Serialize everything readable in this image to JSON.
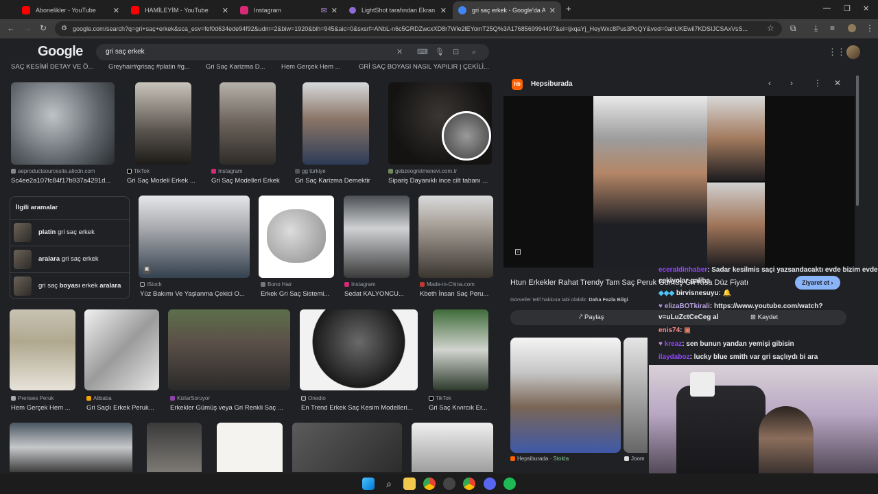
{
  "browser": {
    "tabs": [
      {
        "title": "Abonelikler - YouTube",
        "color": "#ff0000"
      },
      {
        "title": "HAMİLEYİM - YouTube",
        "color": "#ff0000"
      },
      {
        "title": "Instagram",
        "color": "#d62976"
      },
      {
        "title": "LightShot tarafından Ekran Gör...",
        "color": "#8e6bd6"
      },
      {
        "title": "gri saç erkek - Google'da Ara",
        "color": "#4285f4"
      }
    ],
    "url": "google.com/search?q=gri+saç+erkek&sca_esv=fef0d634ede94f92&udm=2&biw=1920&bih=945&aic=0&sxsrf=ANbL-n6c5GRDZwcxXD8r7Wle2lEYomT25Q%3A1768569994497&ei=ijxqaYj_HeyWxc8Pus3PoQY&ved=0ahUKEwil7KDSIJCSAxVsS..."
  },
  "google": {
    "logo": "Google",
    "query": "gri saç erkek",
    "chips": [
      "SAÇ KESİMİ DETAY VE Ö...",
      "Greyhair#grisaç #platin #g...",
      "Gri Saç Karizma D...",
      "Hem Gerçek Hem ...",
      "GRİ SAÇ BOYASI NASIL YAPILIR | ÇEKİLİ..."
    ]
  },
  "results": {
    "row1": [
      {
        "source": "aeproductsourcesite.alicdn.com",
        "caption": "Sc4ee2a107fc84f17b937a4291d..."
      },
      {
        "source": "TikTok",
        "caption": "Gri Saç Modeli Erkek ..."
      },
      {
        "source": "Instagram",
        "caption": "Gri Saç Modelleri Erkek"
      },
      {
        "source": "gg türkiye",
        "caption": "Gri Saç Karizma Demektir"
      },
      {
        "source": "gebzeogretmenevi.com.tr",
        "caption": "Sipariş Dayanıklı ince cilt tabanı ..."
      }
    ],
    "row2": [
      {
        "source": "iStock",
        "caption": "Yüz Bakımı Ve Yaşlanma Çekici O..."
      },
      {
        "source": "Bono Hair",
        "caption": "Erkek Gri Saç Sistemi..."
      },
      {
        "source": "Instagram",
        "caption": "Sedat KALYONCU..."
      },
      {
        "source": "Made-in-China.com",
        "caption": "Kbeth İnsan Saç Peru..."
      }
    ],
    "row3": [
      {
        "source": "Prenses Peruk",
        "caption": "Hem Gerçek Hem ..."
      },
      {
        "source": "Alibaba",
        "caption": "Gri Saçlı Erkek Peruk..."
      },
      {
        "source": "KizlarSoruyor",
        "caption": "Erkekler Gümüş veya Gri Renkli Saç ..."
      },
      {
        "source": "Onedio",
        "caption": "En Trend Erkek Saç Kesim Modelleri..."
      },
      {
        "source": "TikTok",
        "caption": "Gri Saç Kıvırcık Er..."
      }
    ]
  },
  "related": {
    "heading": "İlgili aramalar",
    "items": [
      {
        "bold": "platin",
        "rest": " gri saç erkek"
      },
      {
        "bold": "aralara",
        "rest": " gri saç erkek"
      },
      {
        "pre": "gri saç ",
        "bold": "boyası",
        "mid": " erkek ",
        "bold2": "aralara"
      }
    ]
  },
  "panel": {
    "site": "Hepsiburada",
    "title": "Htun Erkekler Rahat Trendy Tam Saç Peruk Gümüş Gri Kısa Düz Fiyatı",
    "visit": "Ziyaret et",
    "copyright": "Görseller telif hakkına tabi olabilir.",
    "more_info": "Daha Fazla Bilgi",
    "share": "Paylaş",
    "save": "Kaydet",
    "bottom_source": "Hepsiburada",
    "bottom_stock": "Stokta",
    "bottom_source2": "Joom"
  },
  "stream_chat": [
    {
      "user": "eceraldinhaber",
      "text": ": Sadar kesilmis saçi yazsandacaktı evde bizim evden...",
      "color": "#9146ff"
    },
    {
      "user": "",
      "text": "cekiyolar galiba",
      "color": "#e8eaed"
    },
    {
      "user": "birvisnesuyu",
      "text": ":",
      "color": "#e8eaed"
    },
    {
      "user": "elizaBOTkirali",
      "text": ": https://www.youtube.com/watch?",
      "color": "#b9a3e3"
    },
    {
      "user": "",
      "text": "v=uLuZctCeCeg al",
      "color": "#e8eaed"
    },
    {
      "user": "enis74",
      "text": ":",
      "color": "#ff8c8c"
    },
    {
      "user": "kreaz",
      "text": ": sen bunun yandan yemişi gibisin",
      "color": "#9146ff"
    },
    {
      "user": "ilaydaboz",
      "text": ": lucky blue smith var gri saçlıydı bi ara",
      "color": "#9146ff"
    }
  ]
}
